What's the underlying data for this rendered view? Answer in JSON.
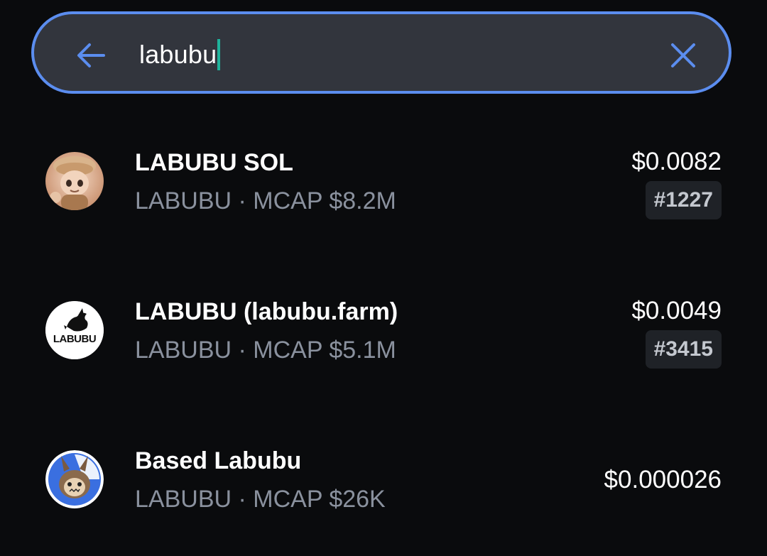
{
  "search": {
    "query": "labubu",
    "back_icon": "arrow-left-icon",
    "clear_icon": "close-icon",
    "accent_color": "#5b8def",
    "caret_color": "#1fb39c"
  },
  "results": [
    {
      "name": "LABUBU SOL",
      "subtitle": "LABUBU · MCAP $8.2M",
      "price": "$0.0082",
      "rank": "#1227",
      "avatar_icon": "labubu-doll-avatar-icon"
    },
    {
      "name": "LABUBU (labubu.farm)",
      "subtitle": "LABUBU · MCAP $5.1M",
      "price": "$0.0049",
      "rank": "#3415",
      "avatar_icon": "labubu-logo-avatar-icon",
      "avatar_logo_text": "LABUBU"
    },
    {
      "name": "Based Labubu",
      "subtitle": "LABUBU · MCAP $26K",
      "price": "$0.000026",
      "avatar_icon": "based-labubu-avatar-icon"
    }
  ]
}
